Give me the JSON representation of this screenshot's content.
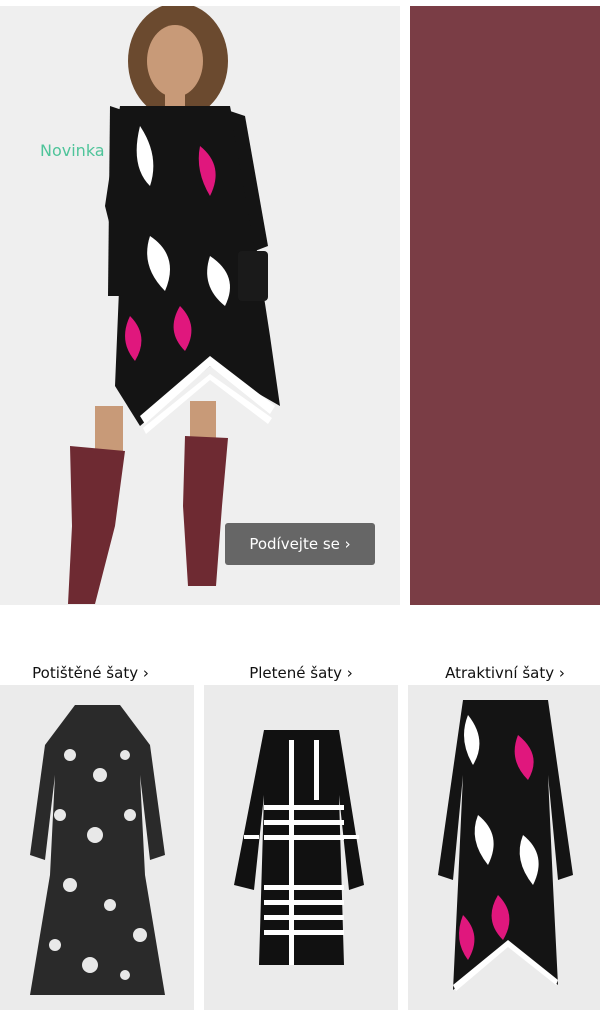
{
  "hero": {
    "badge": "Novinka",
    "cta_label": "Podívejte se ›",
    "swatch_color": "#7a3d45"
  },
  "categories": [
    {
      "label": "Potištěné šaty ›"
    },
    {
      "label": "Pletené šaty ›"
    },
    {
      "label": "Atraktivní šaty ›"
    }
  ]
}
